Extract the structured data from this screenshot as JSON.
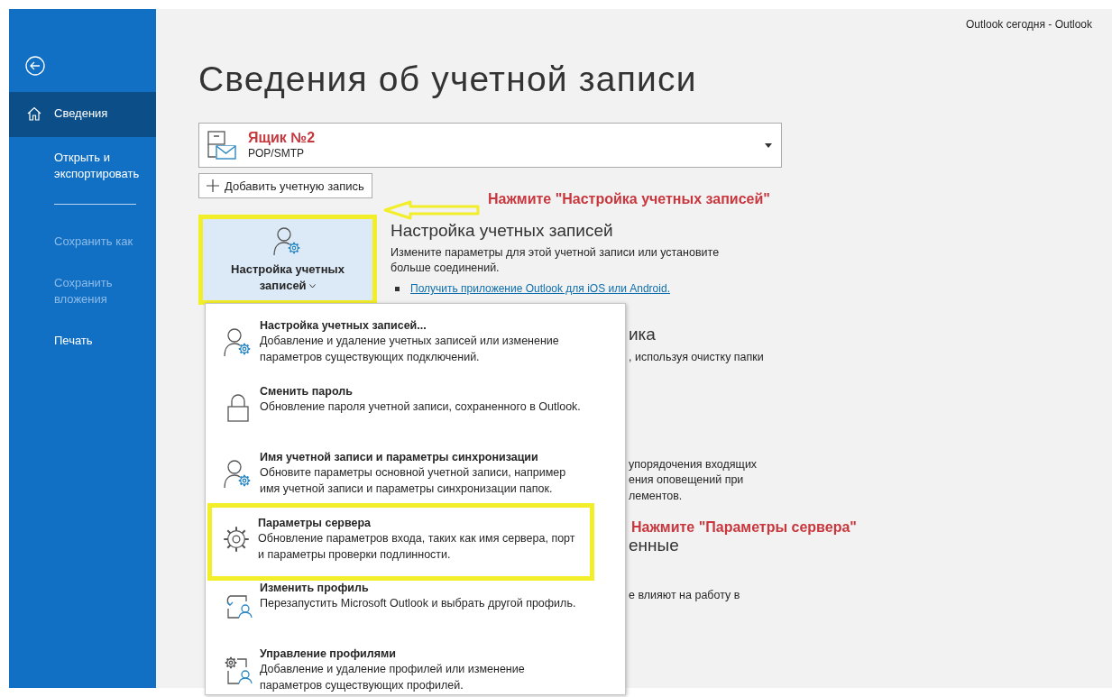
{
  "window": {
    "title": "Outlook сегодня  -  Outlook"
  },
  "sidebar": {
    "items": [
      {
        "kind": "back"
      },
      {
        "kind": "home",
        "label": "Сведения",
        "selected": true,
        "disabled": false
      },
      {
        "kind": "text",
        "label": "Открыть и экспортировать",
        "selected": false,
        "disabled": false
      },
      {
        "kind": "divider"
      },
      {
        "kind": "text",
        "label": "Сохранить как",
        "selected": false,
        "disabled": true
      },
      {
        "kind": "text",
        "label": "Сохранить вложения",
        "selected": false,
        "disabled": true
      },
      {
        "kind": "text",
        "label": "Печать",
        "selected": false,
        "disabled": false
      }
    ]
  },
  "page": {
    "title": "Сведения об учетной записи",
    "account": {
      "name": "Ящик №2",
      "type": "POP/SMTP"
    },
    "add_account_button": "Добавить учетную запись",
    "account_settings_button": {
      "label": "Настройка учетных записей",
      "highlighted": true
    },
    "section": {
      "heading": "Настройка учетных записей",
      "description": "Измените параметры для этой учетной записи или установите больше соединений.",
      "link": "Получить приложение Outlook для iOS или Android."
    },
    "hidden_sections": [
      {
        "heading": "ика",
        "lines": [
          ", используя очистку папки"
        ]
      },
      {
        "lines": [
          "упорядочения входящих",
          "ения оповещений при",
          "лементов."
        ]
      },
      {
        "heading": "енные",
        "lines": [
          "е влияют на работу в"
        ]
      }
    ]
  },
  "dropdown_menu": {
    "items": [
      {
        "title": "Настройка учетных записей...",
        "description": "Добавление и удаление учетных записей или изменение параметров существующих подключений.",
        "highlighted": false
      },
      {
        "title": "Сменить пароль",
        "description": "Обновление пароля учетной записи, сохраненного в Outlook.",
        "highlighted": false
      },
      {
        "title": "Имя учетной записи и параметры синхронизации",
        "description": "Обновите параметры основной учетной записи, например имя учетной записи и параметры синхронизации папок.",
        "highlighted": false
      },
      {
        "title": "Параметры сервера",
        "description": "Обновление параметров входа, таких как имя сервера, порт и параметры проверки подлинности.",
        "highlighted": true
      },
      {
        "title": "Изменить профиль",
        "description": "Перезапустить Microsoft Outlook и выбрать другой профиль.",
        "highlighted": false
      },
      {
        "title": "Управление профилями",
        "description": "Добавление и удаление профилей или изменение параметров существующих профилей.",
        "highlighted": false
      }
    ]
  },
  "annotations": [
    {
      "kind": "note",
      "text": "Нажмите \"Настройка учетных записей\""
    },
    {
      "kind": "arrow"
    },
    {
      "kind": "note",
      "text": "Нажмите \"Параметры сервера\""
    }
  ]
}
